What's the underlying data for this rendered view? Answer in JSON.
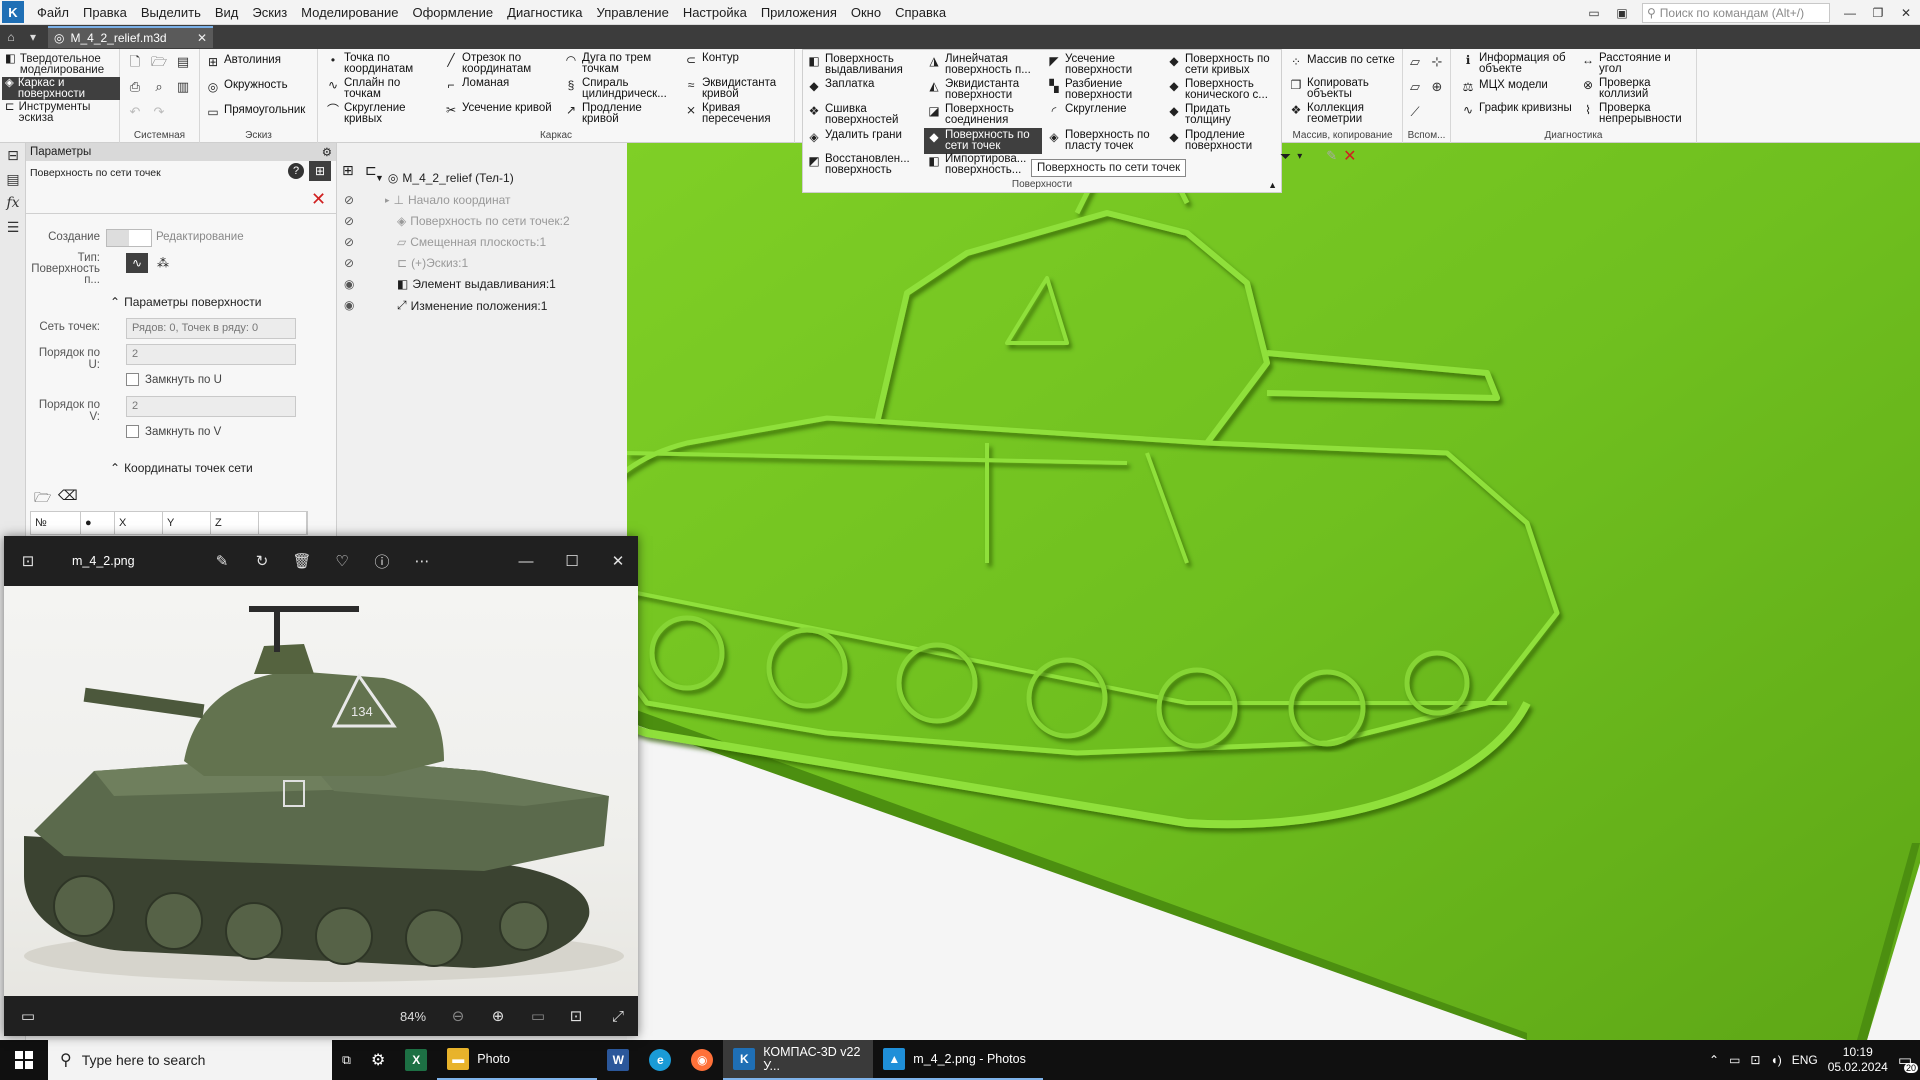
{
  "menubar": {
    "items": [
      "Файл",
      "Правка",
      "Выделить",
      "Вид",
      "Эскиз",
      "Моделирование",
      "Оформление",
      "Диагностика",
      "Управление",
      "Настройка",
      "Приложения",
      "Окно",
      "Справка"
    ],
    "search_placeholder": "Поиск по командам (Alt+/)"
  },
  "tabbar": {
    "doc_tab": "M_4_2_relief.m3d"
  },
  "ribbon": {
    "modes": [
      "Твердотельное моделирование",
      "Каркас и поверхности",
      "Инструменты эскиза"
    ],
    "groups": {
      "system": "Системная",
      "sketch": "Эскиз",
      "frame": "Каркас",
      "surfaces": "Поверхности",
      "array": "Массив, копирование",
      "aux": "Вспом...",
      "diag": "Диагностика"
    },
    "sketch_buttons": [
      "Автолиния",
      "Окружность",
      "Прямоугольник"
    ],
    "frame_col1": [
      "Точка по координатам",
      "Сплайн по точкам",
      "Скругление кривых"
    ],
    "frame_col2": [
      "Отрезок по координатам",
      "Ломаная",
      "Усечение кривой"
    ],
    "frame_col3": [
      "Дуга по трем точкам",
      "Спираль цилиндрическ...",
      "Продление кривой"
    ],
    "frame_col4": [
      "Контур",
      "Эквидистанта кривой",
      "Кривая пересечения"
    ],
    "surf_col1": [
      "Поверхность выдавливания",
      "Заплатка",
      "Сшивка поверхностей",
      "Удалить грани",
      "Восстановлен... поверхность"
    ],
    "surf_col2": [
      "Линейчатая поверхность п...",
      "Эквидистанта поверхности",
      "Поверхность соединения",
      "Поверхность по сети точек",
      "Импортирова... поверхность..."
    ],
    "surf_col3": [
      "Усечение поверхности",
      "Разбиение поверхности",
      "Скругление",
      "Поверхность по пласту точек"
    ],
    "surf_col4": [
      "Поверхность по сети кривых",
      "Поверхность конического с...",
      "Придать толщину",
      "Продление поверхности"
    ],
    "array_buttons": [
      "Массив по сетке",
      "Копировать объекты",
      "Коллекция геометрии"
    ],
    "diag_col1": [
      "Информация об объекте",
      "МЦХ модели",
      "График кривизны"
    ],
    "diag_col2": [
      "Расстояние и угол",
      "Проверка коллизий",
      "Проверка непрерывности"
    ]
  },
  "params": {
    "title": "Параметры",
    "description": "Поверхность по сети точек",
    "mode_create": "Создание",
    "mode_edit": "Редактирование",
    "type_label": "Тип: Поверхность п...",
    "section_surface": "Параметры поверхности",
    "grid_label": "Сеть точек:",
    "grid_value": "Рядов: 0, Точек в ряду: 0",
    "order_u_label": "Порядок по U:",
    "order_u_value": "2",
    "close_u": "Замкнуть по U",
    "order_v_label": "Порядок по V:",
    "order_v_value": "2",
    "close_v": "Замкнуть по V",
    "section_coords": "Координаты точек сети",
    "table_cols": [
      "№",
      "●",
      "X",
      "Y",
      "Z"
    ]
  },
  "tree": {
    "root": "M_4_2_relief (Тел-1)",
    "items": [
      "Начало координат",
      "Поверхность по сети точек:2",
      "Смещенная плоскость:1",
      "(+)Эскиз:1",
      "Элемент выдавливания:1",
      "Изменение положения:1"
    ]
  },
  "tooltip": "Поверхность по сети точек",
  "photos": {
    "filename": "m_4_2.png",
    "zoom": "84%",
    "tank_number": "134"
  },
  "taskbar": {
    "search_placeholder": "Type here to search",
    "apps": [
      "Photo",
      "КОМПАС-3D v22 У...",
      "m_4_2.png - Photos"
    ],
    "lang": "ENG",
    "time": "10:19",
    "date": "05.02.2024",
    "notif_count": "20"
  },
  "colors": {
    "relief_green": "#6fbf1f",
    "active_button": "#3f3f3f",
    "taskbar": "#101010"
  }
}
